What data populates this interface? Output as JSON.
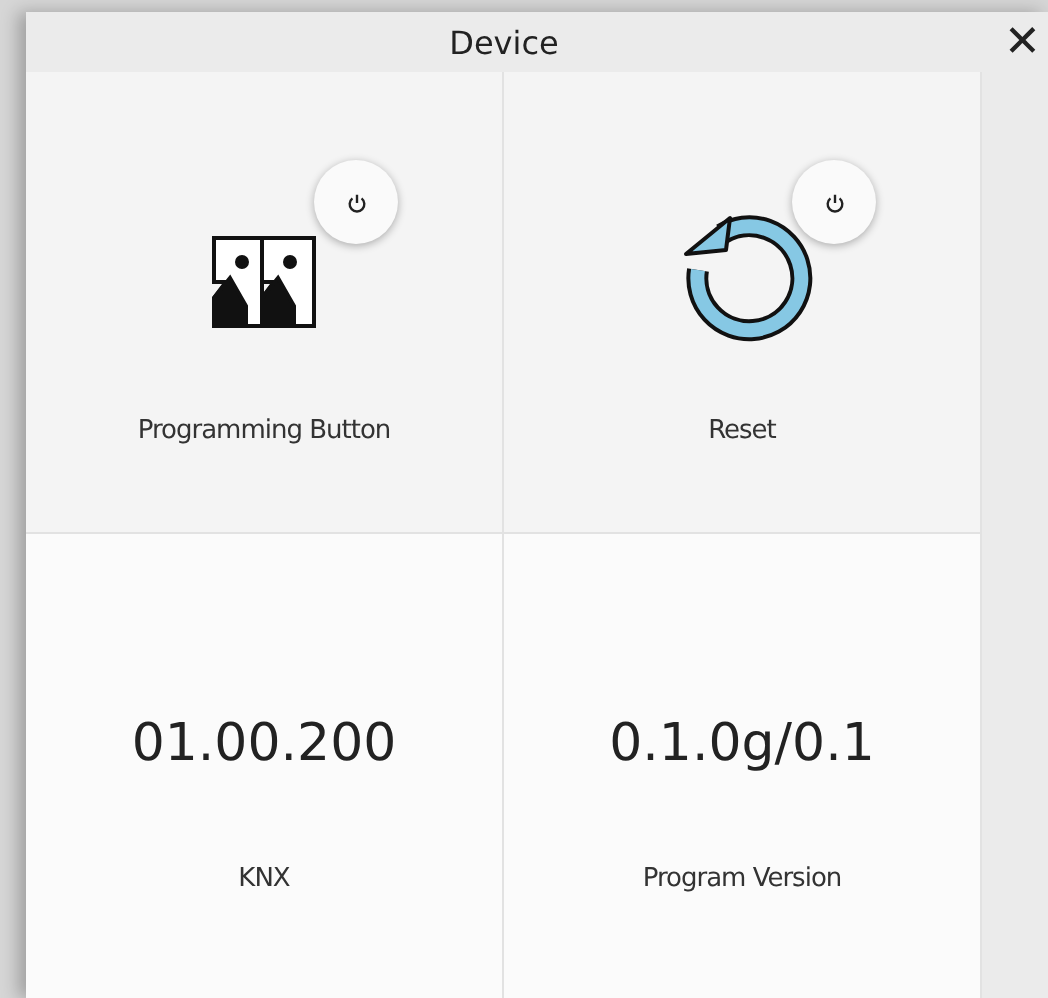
{
  "window": {
    "title": "Device",
    "close": "✕"
  },
  "tiles": [
    {
      "kind": "action",
      "label": "Programming Button"
    },
    {
      "kind": "action",
      "label": "Reset"
    },
    {
      "kind": "value",
      "value": "01.00.200",
      "label": "KNX"
    },
    {
      "kind": "value",
      "value": "0.1.0g/0.1",
      "label": "Program Version"
    }
  ]
}
